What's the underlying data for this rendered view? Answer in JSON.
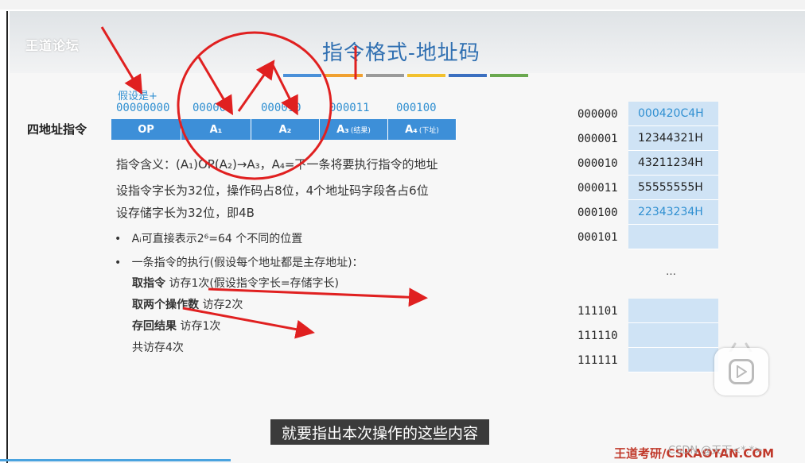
{
  "slide": {
    "logo": "王道论坛",
    "title": "指令格式-地址码",
    "accent_colors": [
      "#4a90d9",
      "#f0a030",
      "#9a9a9a",
      "#f2c12e",
      "#3b6fc0",
      "#6aa84f"
    ]
  },
  "instruction": {
    "hint": "假设是+",
    "row_label": "四地址指令",
    "addr_labels": [
      "00000000",
      "000001",
      "000010",
      "000011",
      "000100"
    ],
    "fields": [
      {
        "label": "OP",
        "note": ""
      },
      {
        "label": "A₁",
        "note": ""
      },
      {
        "label": "A₂",
        "note": ""
      },
      {
        "label": "A₃",
        "note": "(结果)"
      },
      {
        "label": "A₄",
        "note": "(下址)"
      }
    ]
  },
  "text": {
    "line1": "指令含义：(A₁)OP(A₂)→A₃，A₄=下一条将要执行指令的地址",
    "line2": "设指令字长为32位，操作码占8位，4个地址码字段各占6位",
    "line3": "设存储字长为32位，即4B",
    "bullet1": "Aᵢ可直接表示2⁶=64 个不同的位置",
    "bullet2": "一条指令的执行(假设每个地址都是主存地址)：",
    "fetch_b": "取指令",
    "fetch_n": " 访存1次(假设指令字长=存储字长)",
    "ops_b": "取两个操作数",
    "ops_n": " 访存2次",
    "store_b": "存回结果",
    "store_n": " 访存1次",
    "total": "共访存4次"
  },
  "memory": {
    "rows": [
      {
        "addr": "000000",
        "value": "000420C4H",
        "highlight": true
      },
      {
        "addr": "000001",
        "value": "12344321H",
        "highlight": false
      },
      {
        "addr": "000010",
        "value": "43211234H",
        "highlight": false
      },
      {
        "addr": "000011",
        "value": "55555555H",
        "highlight": false
      },
      {
        "addr": "000100",
        "value": "22343234H",
        "highlight": true
      },
      {
        "addr": "000101",
        "value": "",
        "highlight": false
      }
    ],
    "ellipsis": "…",
    "tail_rows": [
      {
        "addr": "111101",
        "value": ""
      },
      {
        "addr": "111110",
        "value": ""
      },
      {
        "addr": "111111",
        "value": ""
      }
    ]
  },
  "overlay": {
    "caption": "就要指出本次操作的这些内容",
    "watermark": "王道考研/CSKAOYAN.COM",
    "csdn": "CSDN @天下<*.*>",
    "play_icon": "play-icon",
    "annotation_color": "#e02020"
  }
}
